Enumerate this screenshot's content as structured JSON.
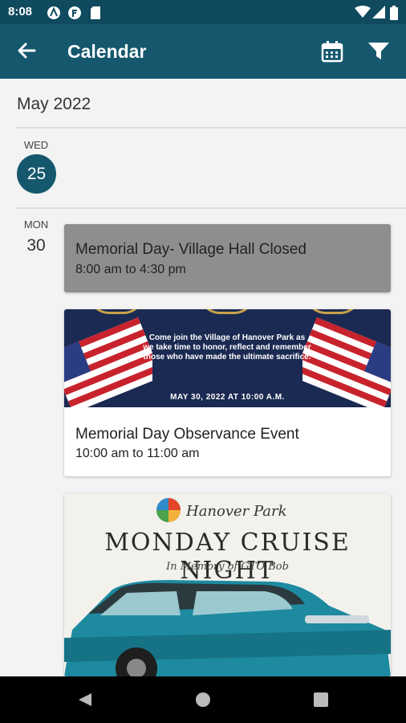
{
  "status_bar": {
    "time": "8:08"
  },
  "app_bar": {
    "title": "Calendar"
  },
  "month_header": "May 2022",
  "days": [
    {
      "dow": "WED",
      "day": "25"
    },
    {
      "dow": "MON",
      "day": "30"
    }
  ],
  "events": [
    {
      "title": "Memorial Day- Village Hall Closed",
      "time": "8:00 am to 4:30 pm"
    },
    {
      "title": "Memorial Day Observance Event",
      "time": "10:00 am to 11:00 am",
      "banner_text": "Come join the Village of Hanover Park as we take time to honor, reflect and remember those who have made the ultimate sacrifice.",
      "banner_date": "MAY 30, 2022 AT 10:00 A.M."
    },
    {
      "poster_logo_text": "Hanover Park",
      "poster_title": "MONDAY CRUISE NIGHT",
      "poster_subtitle": "In Memory of GTO Bob"
    }
  ],
  "colors": {
    "primary": "#15586e",
    "status_bar": "#0f4a5e",
    "closed_card": "#8e8e8e"
  },
  "icons": [
    "back-arrow-icon",
    "calendar-icon",
    "filter-icon",
    "wifi-icon",
    "signal-icon",
    "battery-icon",
    "nav-back-icon",
    "nav-home-icon",
    "nav-recents-icon"
  ]
}
